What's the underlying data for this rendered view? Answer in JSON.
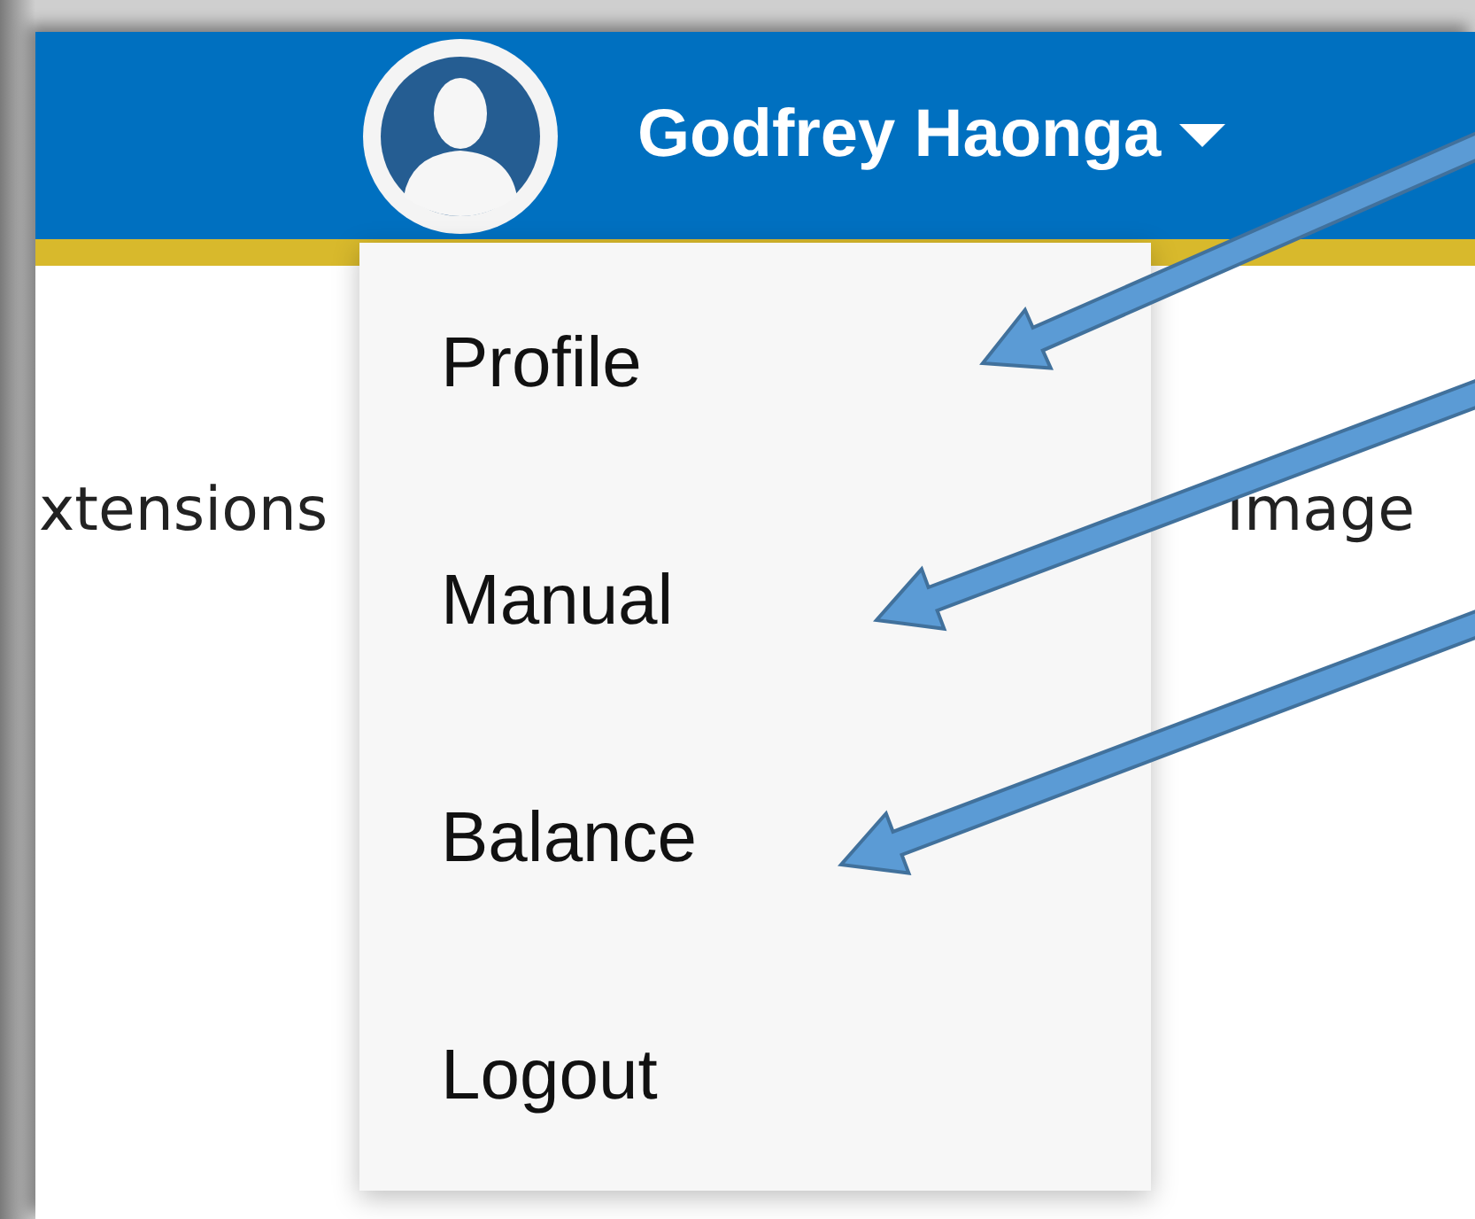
{
  "header": {
    "user_name": "Godfrey Haonga",
    "menu_expanded": true
  },
  "page_text": [
    "xtensions",
    "Image"
  ],
  "menu": {
    "items": [
      {
        "label": "Profile",
        "annotated": true
      },
      {
        "label": "Manual",
        "annotated": true
      },
      {
        "label": "Balance",
        "annotated": true
      },
      {
        "label": "Logout",
        "annotated": false
      }
    ]
  }
}
